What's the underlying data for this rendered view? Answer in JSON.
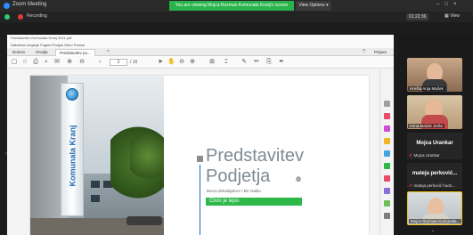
{
  "zoom": {
    "window_title": "Zoom Meeting",
    "banner": "You are viewing Mojca Rozman Komunala Kranj's screen",
    "view_options": "View Options ▾",
    "recording": "Recording",
    "time": "01:22:36",
    "view_label": "View",
    "brand_blue": "#2d8cff",
    "banner_green": "#29b34a"
  },
  "pdf": {
    "title_bar": "Predstavitev-Komunala Kranj 2021.pdf",
    "menu": "Datoteka  Urejanje  Pogled  Podpis  Okno  Pomoč",
    "tabs": [
      "Domov",
      "Orodja",
      "Predstavitev po..."
    ],
    "share": "Prijava",
    "page_input": "1",
    "page_total": "/ 16"
  },
  "slide": {
    "sign_text": "Komunala Kranj",
    "title_line1": "Predstavitev",
    "title_line2": "Podjetja",
    "subtitle": "Borza delodajalcev / BC Naklo",
    "green_box": "Čisto je lepo.",
    "accent_green": "#2eb84a",
    "accent_blue": "#1e67b0"
  },
  "participants": [
    {
      "name": "Hrešta Anja Maček",
      "type": "video"
    },
    {
      "name": "Irena Maček Jerše",
      "type": "video"
    },
    {
      "display": "Mojca Urankar",
      "name": "Mojca Urankar",
      "type": "tile"
    },
    {
      "display": "mateja perković...",
      "name": "mateja perković hudo...",
      "type": "tile"
    },
    {
      "name": "Mojca Rozman Komunala...",
      "type": "video"
    }
  ]
}
